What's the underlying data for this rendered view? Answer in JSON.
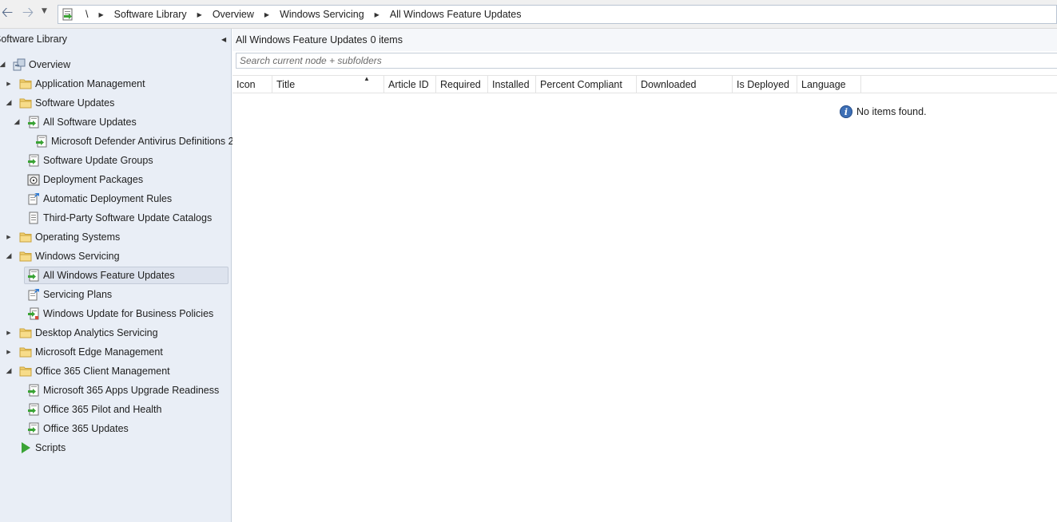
{
  "toolbar": {
    "back_icon": "back-arrow-icon",
    "forward_icon": "forward-arrow-icon",
    "history_icon": "dropdown-icon"
  },
  "breadcrumb": {
    "root": "\\",
    "items": [
      "Software Library",
      "Overview",
      "Windows Servicing",
      "All Windows Feature Updates"
    ]
  },
  "sidebar": {
    "title": "Software Library",
    "tree": [
      {
        "label": "Overview",
        "icon": "overview-icon",
        "expander": "expanded"
      },
      {
        "label": "Application Management",
        "icon": "folder-icon",
        "expander": "collapsed"
      },
      {
        "label": "Software Updates",
        "icon": "folder-icon",
        "expander": "expanded"
      },
      {
        "label": "All Software Updates",
        "icon": "update-icon",
        "expander": "expanded"
      },
      {
        "label": "Microsoft Defender Antivirus Definitions 2",
        "icon": "update-icon",
        "expander": ""
      },
      {
        "label": "Software Update Groups",
        "icon": "update-icon",
        "expander": ""
      },
      {
        "label": "Deployment Packages",
        "icon": "package-icon",
        "expander": ""
      },
      {
        "label": "Automatic Deployment Rules",
        "icon": "rule-icon",
        "expander": ""
      },
      {
        "label": "Third-Party Software Update Catalogs",
        "icon": "catalog-icon",
        "expander": ""
      },
      {
        "label": "Operating Systems",
        "icon": "folder-icon",
        "expander": "collapsed"
      },
      {
        "label": "Windows Servicing",
        "icon": "folder-icon",
        "expander": "expanded"
      },
      {
        "label": "All Windows Feature Updates",
        "icon": "update-icon",
        "expander": "",
        "selected": true
      },
      {
        "label": "Servicing Plans",
        "icon": "rule-icon",
        "expander": ""
      },
      {
        "label": "Windows Update for Business Policies",
        "icon": "policy-icon",
        "expander": ""
      },
      {
        "label": "Desktop Analytics Servicing",
        "icon": "folder-icon",
        "expander": "collapsed"
      },
      {
        "label": "Microsoft Edge Management",
        "icon": "folder-icon",
        "expander": "collapsed"
      },
      {
        "label": "Office 365 Client Management",
        "icon": "folder-icon",
        "expander": "expanded"
      },
      {
        "label": "Microsoft 365 Apps Upgrade Readiness",
        "icon": "update-icon",
        "expander": ""
      },
      {
        "label": "Office 365 Pilot and Health",
        "icon": "update-icon",
        "expander": ""
      },
      {
        "label": "Office 365 Updates",
        "icon": "update-icon",
        "expander": ""
      },
      {
        "label": "Scripts",
        "icon": "script-icon",
        "expander": ""
      }
    ]
  },
  "main": {
    "title": "All Windows Feature Updates",
    "count": "0 items",
    "search_placeholder": "Search current node + subfolders",
    "columns": [
      "Icon",
      "Title",
      "Article ID",
      "Required",
      "Installed",
      "Percent Compliant",
      "Downloaded",
      "Is Deployed",
      "Language"
    ],
    "sorted_column": "Title",
    "empty_message": "No items found."
  },
  "colors": {
    "sidebar_bg": "#e9eef6",
    "selected_bg": "#dde3ee",
    "folder": "#f3d274",
    "update_green": "#3aa335",
    "info_blue": "#3d6fb6"
  }
}
